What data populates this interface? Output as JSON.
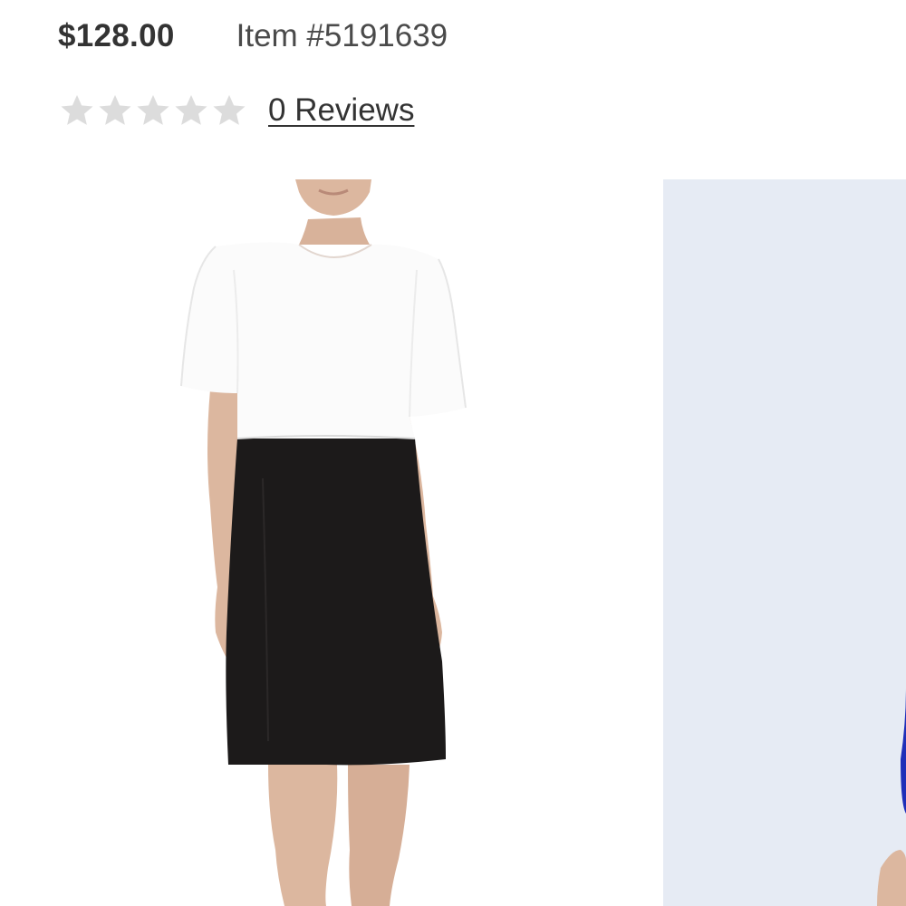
{
  "product": {
    "price": "$128.00",
    "item_number": "Item #5191639"
  },
  "rating": {
    "stars_filled": 0,
    "stars_total": 5,
    "reviews_label": "0 Reviews",
    "star_color_empty": "#dcdcdc"
  },
  "gallery": {
    "images": [
      {
        "name": "product-image-front",
        "description_icon": "dress-photo-icon"
      },
      {
        "name": "product-image-next",
        "description_icon": "dress-photo-icon"
      }
    ],
    "colors": {
      "dress_top": "#fbfbfb",
      "dress_bottom": "#1c1a1a",
      "skin": "#dcb79f",
      "next_background": "#e6ebf4",
      "accent_blue": "#1f2fb8"
    }
  }
}
